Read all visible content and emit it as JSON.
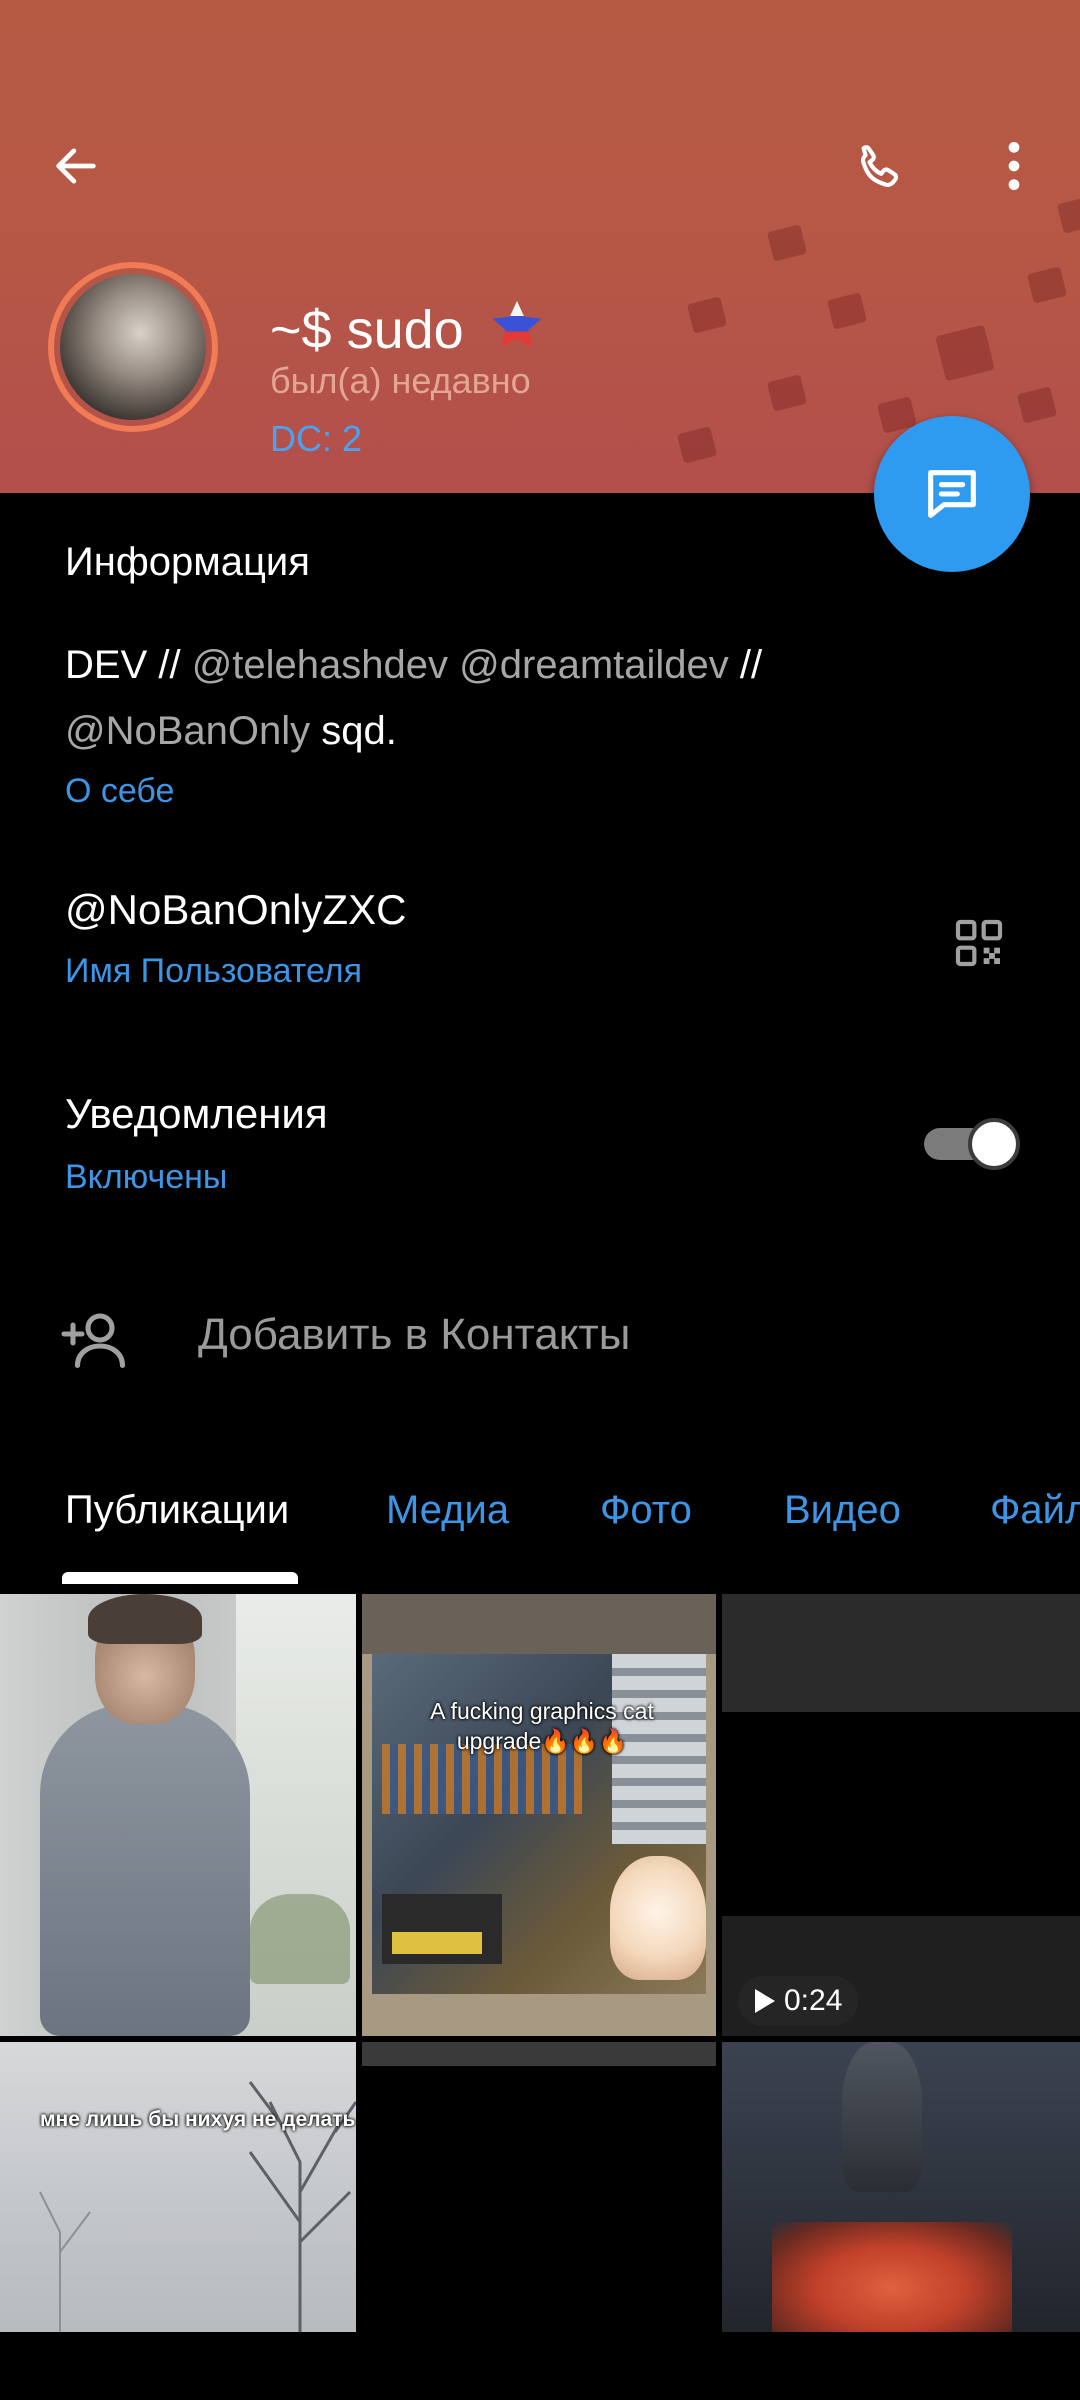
{
  "header": {
    "name": "~$ sudo",
    "status": "был(а) недавно",
    "dc": "DC: 2"
  },
  "info": {
    "section_title": "Информация",
    "bio_prefix": "DEV // ",
    "bio_mention_1": "@telehashdev",
    "bio_mention_2": "@dreamtaildev",
    "bio_sep": " //",
    "bio_mention_3": "@NoBanOnly",
    "bio_suffix": " sqd.",
    "bio_label": "О себе",
    "username": "@NoBanOnlyZXC",
    "username_label": "Имя Пользователя",
    "notifications": "Уведомления",
    "notifications_state": "Включены",
    "notifications_on": true,
    "add_contact": "Добавить в Контакты"
  },
  "tabs": [
    {
      "label": "Публикации",
      "active": true
    },
    {
      "label": "Медиа",
      "active": false
    },
    {
      "label": "Фото",
      "active": false
    },
    {
      "label": "Видео",
      "active": false
    },
    {
      "label": "Файл",
      "active": false
    }
  ],
  "media": {
    "tile2_caption": "A fucking graphics cat upgrade🔥🔥🔥",
    "tile3_duration": "0:24",
    "tile4_caption": "мне лишь бы нихуя не делать"
  },
  "colors": {
    "header_bg": "#b45a43",
    "accent_blue": "#2f9bf0",
    "avatar_ring": "#f07b55"
  }
}
